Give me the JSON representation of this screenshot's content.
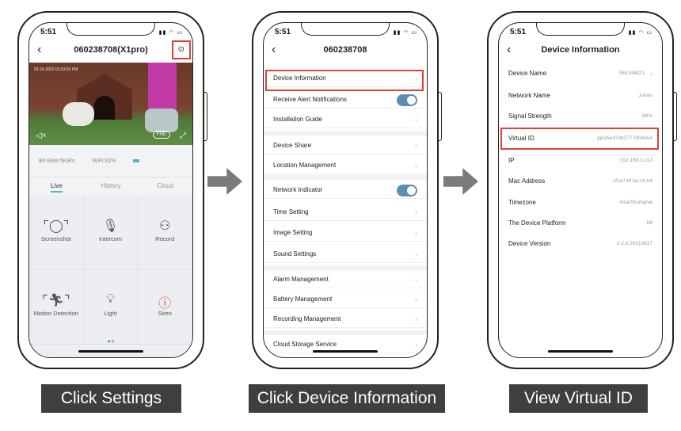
{
  "phone1": {
    "time": "5:51",
    "title": "060238708(X1pro)",
    "timestamp": "02-16-2022 01:53:01 PM",
    "fhd": "FHD",
    "bit_rate": "Bit Rate:5KB/s",
    "wifi": "WiFi:82%",
    "tabs": [
      "Live",
      "History",
      "Cloud"
    ],
    "actions": [
      {
        "label": "Screenshot",
        "icon": "screenshot-icon"
      },
      {
        "label": "Intercom",
        "icon": "microphone-icon"
      },
      {
        "label": "Record",
        "icon": "video-camera-icon"
      },
      {
        "label": "Motion Detection",
        "icon": "motion-icon"
      },
      {
        "label": "Light",
        "icon": "lightbulb-icon"
      },
      {
        "label": "Siren",
        "icon": "alert-icon"
      }
    ]
  },
  "phone2": {
    "time": "5:51",
    "title": "060238708",
    "items": [
      {
        "label": "Device Information"
      },
      {
        "label": "Receive Alert Notifications",
        "toggle": true
      },
      {
        "label": "Installation Guide"
      },
      {
        "label": "Device Share"
      },
      {
        "label": "Location Management"
      },
      {
        "label": "Network Indicator",
        "toggle": true
      },
      {
        "label": "Time Setting"
      },
      {
        "label": "Image Setting"
      },
      {
        "label": "Sound Settings"
      },
      {
        "label": "Alarm Management"
      },
      {
        "label": "Battery Management"
      },
      {
        "label": "Recording Management"
      },
      {
        "label": "Cloud Storage Service"
      }
    ]
  },
  "phone3": {
    "time": "5:51",
    "title": "Device Information",
    "rows": [
      {
        "label": "Device Name",
        "value": "065146821"
      },
      {
        "label": "Network Name",
        "value": "Junan"
      },
      {
        "label": "Signal Strength",
        "value": "88%"
      },
      {
        "label": "Virtual ID",
        "value": "ppsl5e97d43777d04a54"
      },
      {
        "label": "IP",
        "value": "192.168.0.112"
      },
      {
        "label": "Mac Address",
        "value": "c0:e7:bf:ae:cb:b4"
      },
      {
        "label": "Timezone",
        "value": "Asia/Shanghai"
      },
      {
        "label": "The Device Platform",
        "value": "b8"
      },
      {
        "label": "Device Version",
        "value": "2.2.0.20210817"
      }
    ]
  },
  "steps": [
    "Click Settings",
    "Click Device Information",
    "View Virtual ID"
  ],
  "colors": {
    "highlight": "#e0403a",
    "accent": "#5bb5c1",
    "toggle": "#5b8fb0",
    "label_bg": "#3f3f3f"
  }
}
